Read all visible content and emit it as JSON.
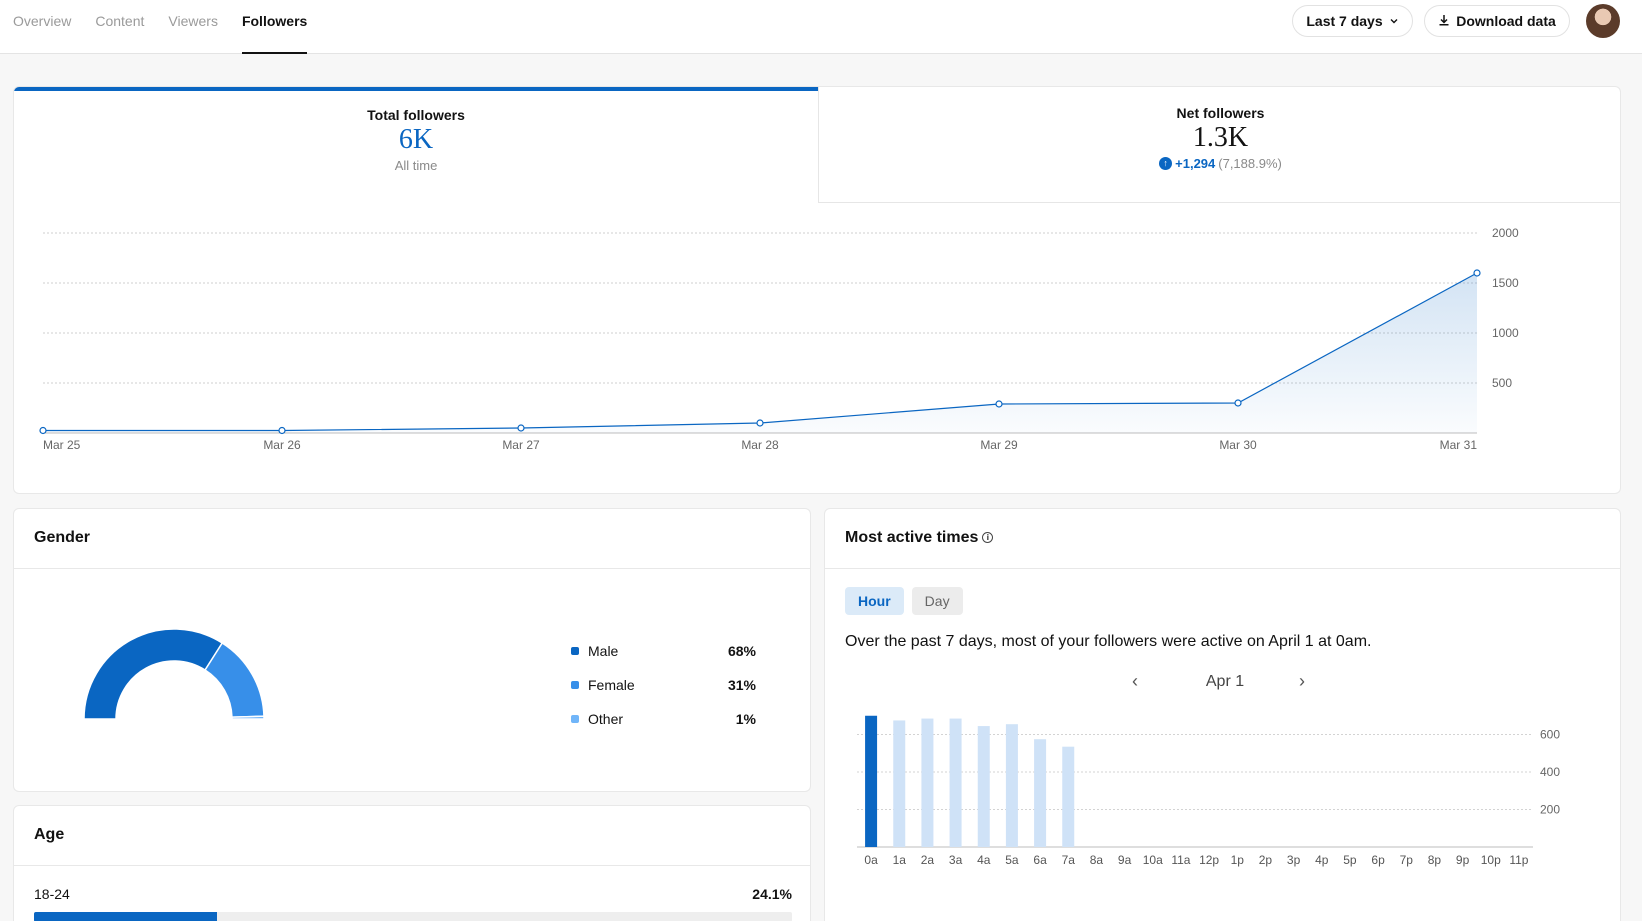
{
  "nav": {
    "tabs": [
      {
        "label": "Overview",
        "active": false
      },
      {
        "label": "Content",
        "active": false
      },
      {
        "label": "Viewers",
        "active": false
      },
      {
        "label": "Followers",
        "active": true
      }
    ],
    "range_label": "Last 7 days",
    "download_label": "Download data"
  },
  "followers": {
    "total": {
      "label": "Total followers",
      "value": "6K",
      "sub": "All time"
    },
    "net": {
      "label": "Net followers",
      "value": "1.3K",
      "change": "+1,294",
      "change_pct": "(7,188.9%)"
    }
  },
  "chart_data": [
    {
      "type": "area",
      "title": "",
      "x": [
        "Mar 25",
        "Mar 26",
        "Mar 27",
        "Mar 28",
        "Mar 29",
        "Mar 30",
        "Mar 31"
      ],
      "y": [
        25,
        25,
        50,
        100,
        290,
        300,
        1600
      ],
      "yticks": [
        500,
        1000,
        1500,
        2000
      ],
      "ylim": [
        0,
        2000
      ],
      "grid": true,
      "color": "#0a66c2"
    },
    {
      "type": "bar",
      "title": "",
      "categories": [
        "0a",
        "1a",
        "2a",
        "3a",
        "4a",
        "5a",
        "6a",
        "7a",
        "8a",
        "9a",
        "10a",
        "11a",
        "12p",
        "1p",
        "2p",
        "3p",
        "4p",
        "5p",
        "6p",
        "7p",
        "8p",
        "9p",
        "10p",
        "11p"
      ],
      "values": [
        700,
        675,
        685,
        685,
        645,
        655,
        575,
        535,
        0,
        0,
        0,
        0,
        0,
        0,
        0,
        0,
        0,
        0,
        0,
        0,
        0,
        0,
        0,
        0
      ],
      "highlight_index": 0,
      "yticks": [
        200,
        400,
        600,
        800
      ],
      "ylim": [
        0,
        800
      ],
      "grid": true,
      "colors": {
        "highlight": "#0a66c2",
        "normal": "#cfe2f7"
      }
    }
  ],
  "gender": {
    "title": "Gender",
    "items": [
      {
        "name": "Male",
        "value": "68%",
        "pct": 68,
        "color": "#0a66c2"
      },
      {
        "name": "Female",
        "value": "31%",
        "pct": 31,
        "color": "#378fe9"
      },
      {
        "name": "Other",
        "value": "1%",
        "pct": 1,
        "color": "#70b5f9"
      }
    ]
  },
  "age": {
    "title": "Age",
    "rows": [
      {
        "label": "18-24",
        "value": "24.1%",
        "pct": 24.1
      }
    ]
  },
  "active": {
    "title": "Most active times",
    "pills": [
      {
        "label": "Hour",
        "active": true
      },
      {
        "label": "Day",
        "active": false
      }
    ],
    "sentence": "Over the past 7 days, most of your followers were active on April 1 at 0am.",
    "date": "Apr 1"
  }
}
